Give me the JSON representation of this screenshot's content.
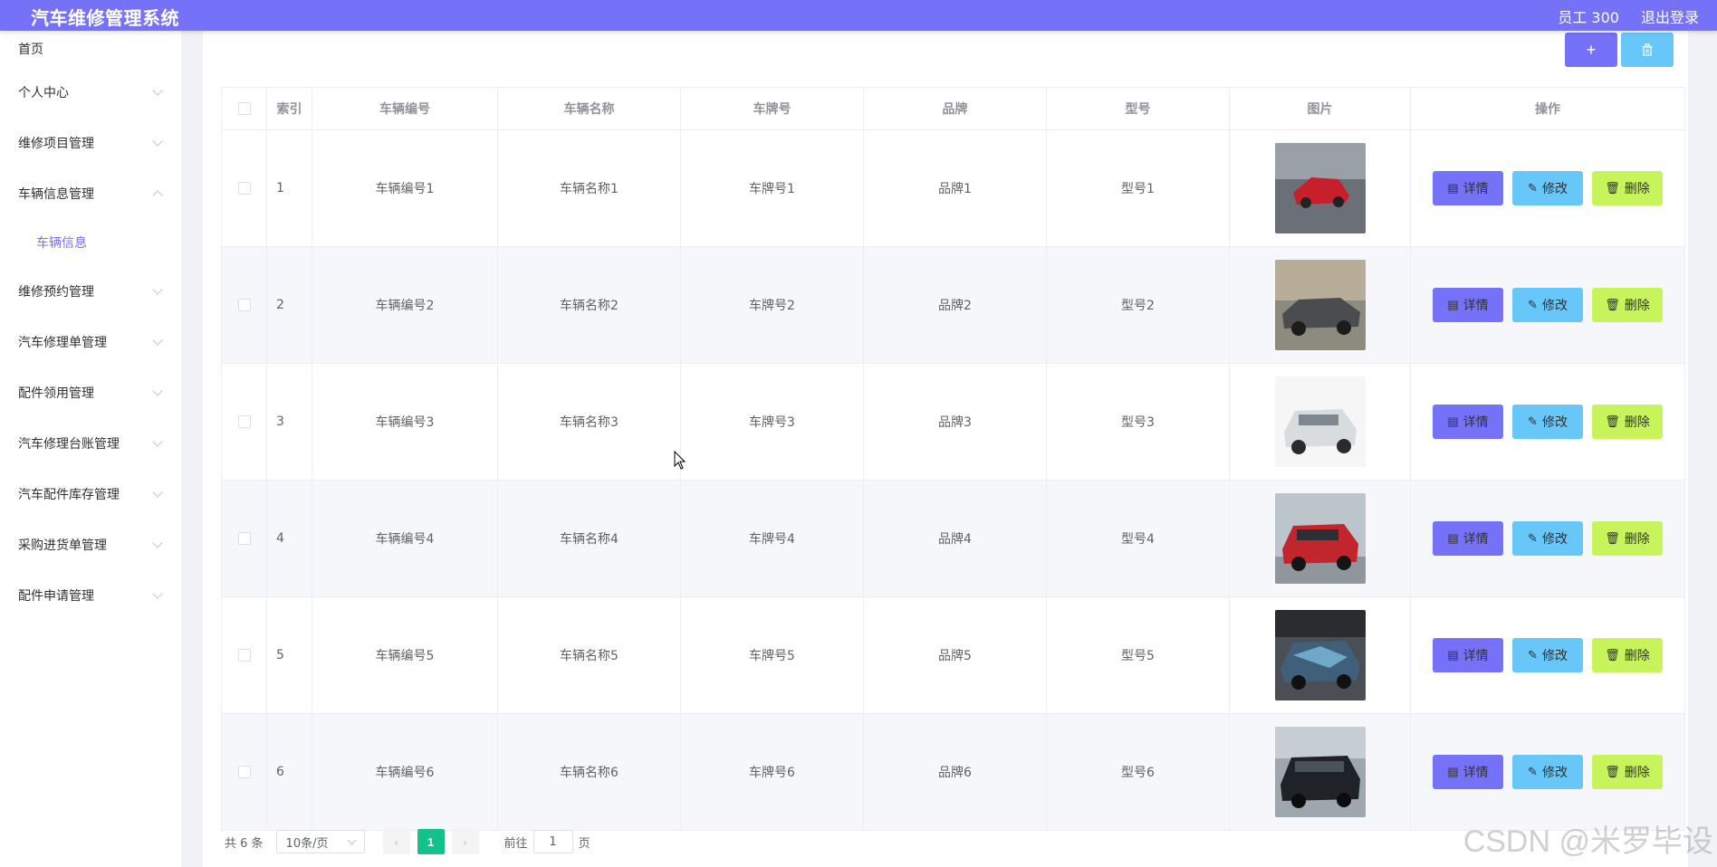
{
  "header": {
    "title": "汽车维修管理系统",
    "user": "员工 300",
    "logout": "退出登录"
  },
  "sidebar": {
    "items": [
      {
        "label": "首页",
        "expandable": false
      },
      {
        "label": "个人中心",
        "expandable": true
      },
      {
        "label": "维修项目管理",
        "expandable": true
      },
      {
        "label": "车辆信息管理",
        "expandable": true,
        "expanded": true
      },
      {
        "label": "维修预约管理",
        "expandable": true
      },
      {
        "label": "汽车修理单管理",
        "expandable": true
      },
      {
        "label": "配件领用管理",
        "expandable": true
      },
      {
        "label": "汽车修理台账管理",
        "expandable": true
      },
      {
        "label": "汽车配件库存管理",
        "expandable": true
      },
      {
        "label": "采购进货单管理",
        "expandable": true
      },
      {
        "label": "配件申请管理",
        "expandable": true
      }
    ],
    "active_sub": "车辆信息"
  },
  "toolbar": {
    "add_icon": "plus-icon",
    "delete_icon": "trash-icon"
  },
  "table": {
    "columns": [
      "索引",
      "车辆编号",
      "车辆名称",
      "车牌号",
      "品牌",
      "型号",
      "图片",
      "操作"
    ],
    "rows": [
      {
        "index": "1",
        "code": "车辆编号1",
        "name": "车辆名称1",
        "plate": "车牌号1",
        "brand": "品牌1",
        "model": "型号1",
        "img": "red-sports-car"
      },
      {
        "index": "2",
        "code": "车辆编号2",
        "name": "车辆名称2",
        "plate": "车牌号2",
        "brand": "品牌2",
        "model": "型号2",
        "img": "gray-muscle-car"
      },
      {
        "index": "3",
        "code": "车辆编号3",
        "name": "车辆名称3",
        "plate": "车牌号3",
        "brand": "品牌3",
        "model": "型号3",
        "img": "white-suv"
      },
      {
        "index": "4",
        "code": "车辆编号4",
        "name": "车辆名称4",
        "plate": "车牌号4",
        "brand": "品牌4",
        "model": "型号4",
        "img": "red-suv"
      },
      {
        "index": "5",
        "code": "车辆编号5",
        "name": "车辆名称5",
        "plate": "车牌号5",
        "brand": "品牌5",
        "model": "型号5",
        "img": "wrapped-hatchback"
      },
      {
        "index": "6",
        "code": "车辆编号6",
        "name": "车辆名称6",
        "plate": "车牌号6",
        "brand": "品牌6",
        "model": "型号6",
        "img": "black-suv"
      }
    ],
    "actions": {
      "detail": "详情",
      "edit": "修改",
      "remove": "删除"
    }
  },
  "pagination": {
    "total": "共 6 条",
    "page_size": "10条/页",
    "current": "1",
    "goto_label": "前往",
    "goto_value": "1",
    "page_unit": "页"
  },
  "colors": {
    "primary": "#7571f9",
    "info": "#67c7f9",
    "warning": "#c6f45a",
    "active_page": "#13c28b"
  },
  "watermark": "CSDN @米罗毕设"
}
